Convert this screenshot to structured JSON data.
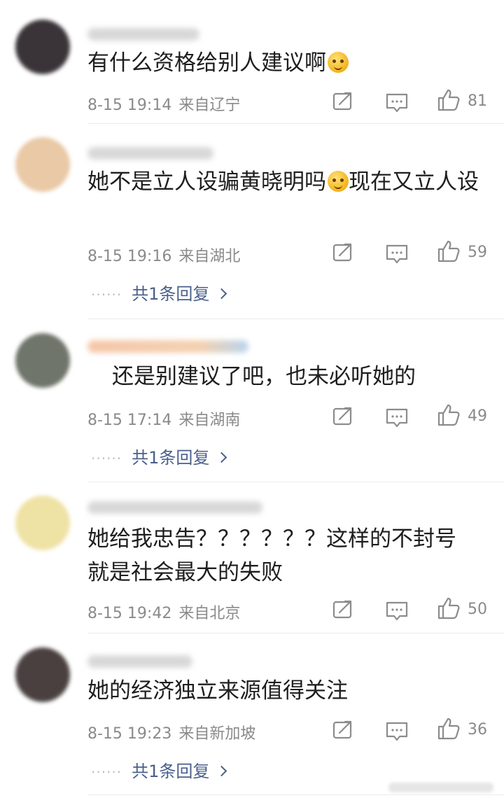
{
  "comments": [
    {
      "text": "有什么资格给别人建议啊",
      "has_emoji": true,
      "emoji_icon": "thinking-face-icon",
      "date": "8-15 19:14",
      "location": "来自辽宁",
      "likes": "81",
      "reply": null
    },
    {
      "text": "她不是立人设骗黄晓明吗",
      "text_after_emoji": "现在又立人设",
      "has_emoji": true,
      "emoji_icon": "dizzy-smile-face-icon",
      "date": "8-15 19:16",
      "location": "来自湖北",
      "likes": "59",
      "reply": "共1条回复"
    },
    {
      "text": "还是别建议了吧，也未必听她的",
      "has_emoji": false,
      "date": "8-15 17:14",
      "location": "来自湖南",
      "likes": "49",
      "reply": "共1条回复"
    },
    {
      "text": "她给我忠告？？？？？？这样的不封号就是社会最大的失败",
      "has_emoji": false,
      "date": "8-15 19:42",
      "location": "来自北京",
      "likes": "50",
      "reply": null
    },
    {
      "text": "她的经济独立来源值得关注",
      "has_emoji": false,
      "date": "8-15 19:23",
      "location": "来自新加坡",
      "likes": "36",
      "reply": "共1条回复"
    }
  ],
  "icons": {
    "share": "share-icon",
    "comment": "comment-icon",
    "like": "thumbs-up-icon",
    "more": "chevron-right-icon"
  },
  "colors": {
    "reply_link": "#4a5f8a",
    "meta": "#8a8a8a",
    "text": "#1e1e1e"
  }
}
